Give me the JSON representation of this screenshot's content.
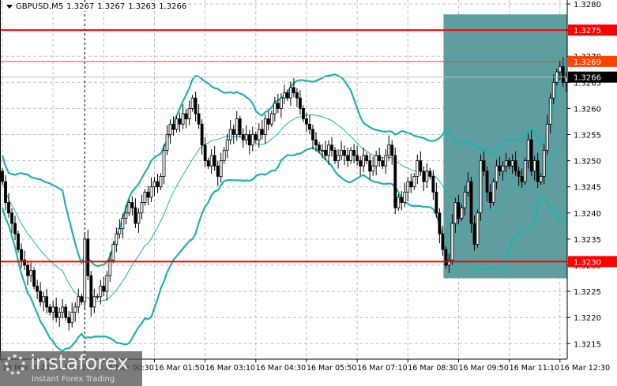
{
  "header": {
    "symbol": "GBPUSD,M5",
    "open": "1.3267",
    "high": "1.3267",
    "low": "1.3263",
    "close": "1.3266"
  },
  "logo": {
    "name": "instaforex",
    "tagline": "Instant Forex Trading"
  },
  "colors": {
    "bull": "#ffffff",
    "bear": "#000000",
    "band": "#20b2aa",
    "zone": "#5f9ea0",
    "red": "#ff0000",
    "orange": "#ff4500",
    "grid": "#c0c0c0"
  },
  "chart_data": {
    "type": "candlestick",
    "title": "GBPUSD,M5",
    "ylim": [
      1.32083,
      1.32807
    ],
    "yticks": [
      "1.3280",
      "1.3275",
      "1.3270",
      "1.3265",
      "1.3260",
      "1.3255",
      "1.3250",
      "1.3245",
      "1.3240",
      "1.3235",
      "1.3230",
      "1.3225",
      "1.3220",
      "1.3215"
    ],
    "xticks": [
      {
        "index": 0,
        "label": "13 Mar 2025"
      },
      {
        "index": 16,
        "label": "13 Mar 23:10"
      },
      {
        "index": 32,
        "label": "16 Mar 00:30"
      },
      {
        "index": 48,
        "label": "16 Mar 01:50"
      },
      {
        "index": 64,
        "label": "16 Mar 03:10"
      },
      {
        "index": 80,
        "label": "16 Mar 04:30"
      },
      {
        "index": 96,
        "label": "16 Mar 05:50"
      },
      {
        "index": 112,
        "label": "16 Mar 07:10"
      },
      {
        "index": 128,
        "label": "16 Mar 08:30"
      },
      {
        "index": 144,
        "label": "16 Mar 09:50"
      },
      {
        "index": 160,
        "label": "16 Mar 11:10"
      },
      {
        "index": 176,
        "label": "16 Mar 12:30"
      }
    ],
    "close": [
      1.3246,
      1.3242,
      1.324,
      1.3238,
      1.3236,
      1.3233,
      1.3231,
      1.323,
      1.3228,
      1.3229,
      1.3226,
      1.3225,
      1.3223,
      1.3224,
      1.3222,
      1.3221,
      1.3222,
      1.322,
      1.3221,
      1.3222,
      1.322,
      1.3219,
      1.3221,
      1.3222,
      1.3224,
      1.3223,
      1.3235,
      1.3228,
      1.3222,
      1.3224,
      1.3224,
      1.3226,
      1.3225,
      1.3228,
      1.3231,
      1.3234,
      1.3236,
      1.3237,
      1.3239,
      1.324,
      1.3242,
      1.3241,
      1.3238,
      1.324,
      1.3242,
      1.3244,
      1.3243,
      1.3245,
      1.3246,
      1.3245,
      1.3247,
      1.3252,
      1.3255,
      1.3257,
      1.3256,
      1.3258,
      1.3257,
      1.3259,
      1.3258,
      1.326,
      1.3262,
      1.3259,
      1.3257,
      1.3253,
      1.325,
      1.3249,
      1.3251,
      1.3249,
      1.3247,
      1.325,
      1.3252,
      1.3254,
      1.3256,
      1.3255,
      1.3258,
      1.3255,
      1.3254,
      1.3255,
      1.3253,
      1.3255,
      1.3254,
      1.3256,
      1.3255,
      1.3258,
      1.3257,
      1.3259,
      1.3261,
      1.326,
      1.3262,
      1.3263,
      1.3262,
      1.3264,
      1.3263,
      1.3262,
      1.326,
      1.3258,
      1.3257,
      1.3256,
      1.3254,
      1.3253,
      1.3252,
      1.3252,
      1.3251,
      1.3253,
      1.3252,
      1.325,
      1.3251,
      1.3252,
      1.3251,
      1.325,
      1.3252,
      1.3251,
      1.325,
      1.3249,
      1.3251,
      1.325,
      1.3248,
      1.3249,
      1.3251,
      1.325,
      1.3249,
      1.3251,
      1.3253,
      1.3251,
      1.3241,
      1.3243,
      1.3242,
      1.3244,
      1.3246,
      1.3245,
      1.3247,
      1.325,
      1.3248,
      1.3246,
      1.3248,
      1.3247,
      1.3244,
      1.324,
      1.3236,
      1.3233,
      1.323,
      1.3231,
      1.3238,
      1.3242,
      1.3239,
      1.3241,
      1.3244,
      1.3246,
      1.3238,
      1.3234,
      1.324,
      1.325,
      1.3248,
      1.3244,
      1.3242,
      1.3246,
      1.3249,
      1.3248,
      1.3249,
      1.325,
      1.3249,
      1.325,
      1.3248,
      1.3247,
      1.3246,
      1.325,
      1.3254,
      1.3248,
      1.325,
      1.3246,
      1.3247,
      1.3252,
      1.3257,
      1.3262,
      1.3265,
      1.3267,
      1.3268,
      1.3265,
      1.3266
    ],
    "levels": [
      {
        "price": 1.3275,
        "label": "1.3275",
        "color": "#ff0000",
        "text": "#ffffff"
      },
      {
        "price": 1.3269,
        "label": "1.3269",
        "color": "#ff4500",
        "text": "#ffffff"
      },
      {
        "price": 1.3266,
        "label": "1.3266",
        "color": "#000000",
        "text": "#ffffff",
        "line": "#c0c0c0"
      },
      {
        "price": 1.32307,
        "label": "1.3230",
        "color": "#ff0000",
        "text": "#ffffff"
      }
    ],
    "zone": {
      "start_index": 140,
      "price_high": 1.3278,
      "price_low": 1.32275
    },
    "cursor_index": 26
  }
}
